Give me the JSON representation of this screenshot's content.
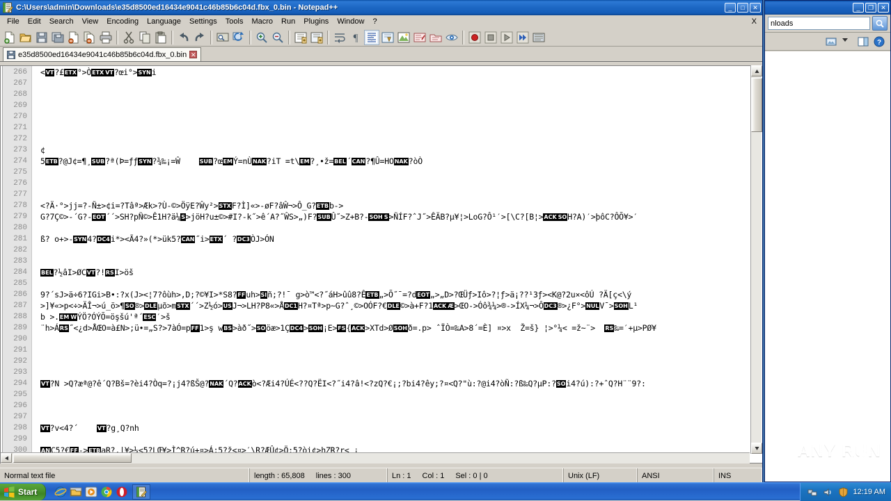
{
  "window": {
    "title": "C:\\Users\\admin\\Downloads\\e35d8500ed16434e9041c46b85b6c04d.fbx_0.bin - Notepad++",
    "minimize_label": "_",
    "maximize_label": "□",
    "close_label": "✕",
    "menu_close_label": "X"
  },
  "menu": {
    "items": [
      {
        "label": "File"
      },
      {
        "label": "Edit"
      },
      {
        "label": "Search"
      },
      {
        "label": "View"
      },
      {
        "label": "Encoding"
      },
      {
        "label": "Language"
      },
      {
        "label": "Settings"
      },
      {
        "label": "Tools"
      },
      {
        "label": "Macro"
      },
      {
        "label": "Run"
      },
      {
        "label": "Plugins"
      },
      {
        "label": "Window"
      },
      {
        "label": "?"
      }
    ]
  },
  "toolbar": {
    "icons": [
      "new-file-icon",
      "open-file-icon",
      "save-icon",
      "save-all-icon",
      "close-file-icon",
      "close-all-icon",
      "print-icon",
      "sep",
      "cut-icon",
      "copy-icon",
      "paste-icon",
      "sep",
      "undo-icon",
      "redo-icon",
      "sep",
      "find-icon",
      "replace-icon",
      "sep",
      "zoom-in-icon",
      "zoom-out-icon",
      "sep",
      "sync-scroll-vertical-icon",
      "sync-scroll-horizontal-icon",
      "sep",
      "word-wrap-icon",
      "show-all-chars-icon",
      "sep",
      "indent-guide-icon",
      "show-symbol-icon",
      "user-defined-dialog-icon",
      "document-map-icon",
      "function-list-icon",
      "sep",
      "start-record-macro-icon",
      "stop-record-macro-icon",
      "playback-macro-icon",
      "run-macro-multiple-icon",
      "save-macro-icon"
    ]
  },
  "tab": {
    "label": "e35d8500ed16434e9041c46b85b6c04d.fbx_0.bin",
    "close_label": "✕"
  },
  "editor": {
    "first_line_number": 266,
    "lines": [
      {
        "n": 266,
        "segs": [
          {
            "t": "<"
          },
          {
            "c": "VT"
          },
          {
            "t": "?£"
          },
          {
            "c": "ETX"
          },
          {
            "t": "°>Ò"
          },
          {
            "c": "ETX"
          },
          {
            "c": "VT"
          },
          {
            "t": "?œi°>"
          },
          {
            "c": "SYN"
          },
          {
            "t": "i"
          }
        ]
      },
      {
        "n": 267,
        "segs": []
      },
      {
        "n": 268,
        "segs": []
      },
      {
        "n": 269,
        "segs": []
      },
      {
        "n": 270,
        "segs": []
      },
      {
        "n": 271,
        "segs": []
      },
      {
        "n": 272,
        "segs": []
      },
      {
        "n": 273,
        "segs": [
          {
            "t": "¢"
          }
        ]
      },
      {
        "n": 274,
        "segs": [
          {
            "t": "5"
          },
          {
            "c": "ETB"
          },
          {
            "t": "?@J¢=¶¸"
          },
          {
            "c": "SUB"
          },
          {
            "t": "?ª(Þ=ƒƒ"
          },
          {
            "c": "SYN"
          },
          {
            "t": "?¾‰¡=Ŵ    "
          },
          {
            "c": "SUB"
          },
          {
            "t": "?œ"
          },
          {
            "c": "EM"
          },
          {
            "t": "Ý=nÙ"
          },
          {
            "c": "NAK"
          },
          {
            "t": "?iT =t\\"
          },
          {
            "c": "EM"
          },
          {
            "t": "?¸•ž="
          },
          {
            "c": "BEL"
          },
          {
            "t": "´"
          },
          {
            "c": "CAN"
          },
          {
            "t": "?¶Û=HO"
          },
          {
            "c": "NAK"
          },
          {
            "t": "?òÒ"
          }
        ]
      },
      {
        "n": 275,
        "segs": []
      },
      {
        "n": 276,
        "segs": []
      },
      {
        "n": 277,
        "segs": []
      },
      {
        "n": 278,
        "segs": [
          {
            "t": "<?Ä·°>jj=?-Ñ±>¢i=?Tâª>Æk>?Ù-©>ÖÿE?Ŵy²>"
          },
          {
            "c": "STX"
          },
          {
            "t": "F?Ì]«>-øF?âŴ¬>Ô_G?"
          },
          {
            "c": "ETB"
          },
          {
            "t": "b->"
          }
        ]
      },
      {
        "n": 279,
        "segs": [
          {
            "t": "G?7Ç©>-´G?-"
          },
          {
            "c": "EOT"
          },
          {
            "t": "´´>SH?pÑ©>Ê1H?ä¼"
          },
          {
            "c": "S"
          },
          {
            "t": ">jöH?u±©>#I?-k˝>ê´A?˝ŴS>„)F?"
          },
          {
            "c": "SUB"
          },
          {
            "t": "Û˝>Z+B?-"
          },
          {
            "c": "SOH"
          },
          {
            "c": "S"
          },
          {
            "t": ">ÑÍF?ˆJ˝>ÊÄB?µ¥¦>LoG?Ô¹′>[\\C?[B¦>"
          },
          {
            "c": "ACK"
          },
          {
            "c": "SO"
          },
          {
            "t": "H?A)′>þôC?ÔÕ¥>′"
          }
        ]
      },
      {
        "n": 280,
        "segs": []
      },
      {
        "n": 281,
        "segs": [
          {
            "t": "ß? o+>-"
          },
          {
            "c": "SYN"
          },
          {
            "t": "4?"
          },
          {
            "c": "DC4"
          },
          {
            "t": "i*><Ã4?»(*>ük5?"
          },
          {
            "c": "CAN"
          },
          {
            "t": "˝i>"
          },
          {
            "c": "ETX"
          },
          {
            "t": "´ ?"
          },
          {
            "c": "DC3"
          },
          {
            "t": "ÒJ>ÓN"
          }
        ]
      },
      {
        "n": 282,
        "segs": []
      },
      {
        "n": 283,
        "segs": []
      },
      {
        "n": 284,
        "segs": [
          {
            "c": "BEL"
          },
          {
            "t": "?½âI>ØC"
          },
          {
            "c": "VT"
          },
          {
            "t": "?!"
          },
          {
            "c": "RS"
          },
          {
            "t": "I>öš"
          }
        ]
      },
      {
        "n": 285,
        "segs": []
      },
      {
        "n": 286,
        "segs": [
          {
            "t": "9?´sJ>ä÷6?IGi>B•:?x(J><¦7?ôùh>,D;?©¥I>*S8?"
          },
          {
            "c": "FF"
          },
          {
            "t": "uh>"
          },
          {
            "c": "SI"
          },
          {
            "t": "ñ;?!¯ g>ò™<?˝áH>ûû8?Ê"
          },
          {
            "c": "ETB"
          },
          {
            "t": "„>Õ˝¯=?d"
          },
          {
            "c": "EOT"
          },
          {
            "t": "„>„D>?ŒÜƒ>Iô>?¦ƒ>ä¡??¹3ƒ><K@?2u×<ôÚ ?Ä[ç<\\ý"
          }
        ]
      },
      {
        "n": 287,
        "segs": [
          {
            "t": ">]¥«>p<÷>ÄÎ¬>ú_ö>¶"
          },
          {
            "c": "SO"
          },
          {
            "t": "®>"
          },
          {
            "c": "DLE"
          },
          {
            "t": "µõ>m"
          },
          {
            "c": "STX"
          },
          {
            "t": "´´>Z½ó>"
          },
          {
            "c": "US"
          },
          {
            "t": "J¬>LH?P8«>Å"
          },
          {
            "c": "DC1"
          },
          {
            "t": "H?¤Tª>p~G?ˆ¸©>OÓF?€"
          },
          {
            "c": "DLE"
          },
          {
            "t": "©>à+F?1"
          },
          {
            "c": "ACK"
          },
          {
            "c": "Æ"
          },
          {
            "t": ">ŒO->Óô¾¼>®->ÍX¼¬>Ô"
          },
          {
            "c": "DC3"
          },
          {
            "t": "®>¿F°>"
          },
          {
            "c": "NUL"
          },
          {
            "t": "V¯>"
          },
          {
            "c": "SOH"
          },
          {
            "t": "L¹"
          }
        ]
      },
      {
        "n": 288,
        "segs": [
          {
            "t": "b >."
          },
          {
            "c": "EM"
          },
          {
            "c": "W"
          },
          {
            "t": "ÝÖ?ÓÝÕ=öşšú'ª´"
          },
          {
            "c": "ESC"
          },
          {
            "t": "′>š"
          }
        ]
      },
      {
        "n": 289,
        "segs": [
          {
            "t": "¨h>Á"
          },
          {
            "c": "RS"
          },
          {
            "t": "˝<¿d>ÅŒO=à£N>;ü•=„S?>7àÓ=p"
          },
          {
            "c": "FF"
          },
          {
            "t": "1>ş w"
          },
          {
            "c": "BS"
          },
          {
            "t": ">àð˝>"
          },
          {
            "c": "SO"
          },
          {
            "t": "öæ>1Ç"
          },
          {
            "c": "DC4"
          },
          {
            "t": ">"
          },
          {
            "c": "SOH"
          },
          {
            "t": "¡E>"
          },
          {
            "c": "FS"
          },
          {
            "t": "{"
          },
          {
            "c": "ACK"
          },
          {
            "t": ">XTd>Ø"
          },
          {
            "c": "SOH"
          },
          {
            "t": "ð=.p> ˆÏÒ=‰A>8´=È] ¤>x  Ž=š} ¦>°¼< =ž~¨>  "
          },
          {
            "c": "RS"
          },
          {
            "t": "‰=′+µ>PØ¥"
          }
        ]
      },
      {
        "n": 290,
        "segs": []
      },
      {
        "n": 291,
        "segs": []
      },
      {
        "n": 292,
        "segs": []
      },
      {
        "n": 293,
        "segs": []
      },
      {
        "n": 294,
        "segs": [
          {
            "c": "VT"
          },
          {
            "t": "?N >Q?æª@?ê´Q?Bš=?èi4?Òq=?¡j4?ßŠ@?"
          },
          {
            "c": "NAK"
          },
          {
            "t": "´Q?"
          },
          {
            "c": "ACK"
          },
          {
            "t": "ò<?Æi4?ÚÉ<??Q?ËI<?˝i4?â!<?zQ?€¡;?bi4?êy;?¤<Q?\"ù:?@i4?òÑ:?ß‰Q?µP:?"
          },
          {
            "c": "SO"
          },
          {
            "t": "i4?ú):?+ˆQ?H¨¨9?:"
          }
        ]
      },
      {
        "n": 295,
        "segs": []
      },
      {
        "n": 296,
        "segs": []
      },
      {
        "n": 297,
        "segs": []
      },
      {
        "n": 298,
        "segs": [
          {
            "c": "VT"
          },
          {
            "t": "?v<4?´    "
          },
          {
            "c": "VT"
          },
          {
            "t": "?g¸Q?nh"
          }
        ]
      },
      {
        "n": 299,
        "segs": []
      },
      {
        "n": 300,
        "segs": [
          {
            "c": "AN"
          },
          {
            "t": "C5?€"
          },
          {
            "c": "FF"
          },
          {
            "t": "->"
          },
          {
            "c": "ETB"
          },
          {
            "t": "aR?,|¥>¼<5?LŒ¥>Ì^R?ú+¤>Á;5?ž<¤>′\\R?ÆÛ¢>Ö:5?òi¢>hZR?r< ¡"
          }
        ]
      }
    ]
  },
  "status": {
    "doc_type": "Normal text file",
    "length_label": "length : 65,808",
    "lines_label": "lines : 300",
    "ln_label": "Ln : 1",
    "col_label": "Col : 1",
    "sel_label": "Sel : 0 | 0",
    "eol": "Unix (LF)",
    "encoding": "ANSI",
    "insert_mode": "INS"
  },
  "explorer": {
    "address_value": "nloads",
    "minimize_label": "_",
    "restore_label": "❐",
    "close_label": "✕",
    "icons": [
      "search-icon",
      "views-icon",
      "chevron-down-icon",
      "organize-pane-icon",
      "help-icon"
    ]
  },
  "watermark": {
    "text": "ANY  RUN"
  },
  "taskbar": {
    "start_label": "Start",
    "quicklaunch": [
      "internet-explorer-icon",
      "file-explorer-icon",
      "media-player-icon",
      "chrome-icon",
      "opera-icon"
    ],
    "tasks": [
      "notepad-plus-plus-task-icon"
    ],
    "tray_icons": [
      "network-icon",
      "volume-icon",
      "shield-icon"
    ],
    "clock": "12:19 AM"
  },
  "colors": {
    "title_blue": "#1d68c4",
    "window_face": "#d4d0c8",
    "editor_bg": "#ffffff",
    "gutter_bg": "#e4e4e4",
    "linenum_fg": "#8c8c8c",
    "control_char_bg": "#000000",
    "taskbar_blue": "#225fc4",
    "start_green": "#47912c"
  }
}
